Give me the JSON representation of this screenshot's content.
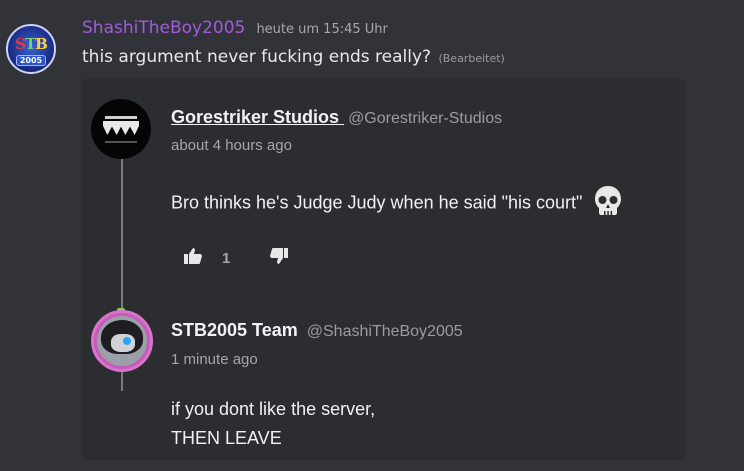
{
  "message": {
    "username": "ShashiTheBoy2005",
    "timestamp": "heute um 15:45 Uhr",
    "text": "this argument never fucking ends really?",
    "edited": "(Bearbeitet)",
    "avatar": {
      "line1": [
        "S",
        "T",
        "B"
      ],
      "line2": "2005"
    }
  },
  "embed": {
    "comment1": {
      "author": "Gorestriker Studios",
      "handle": "@Gorestriker-Studios",
      "time": "about 4 hours ago",
      "text": "Bro thinks he's Judge Judy when he said \"his court\"",
      "emoji_icon": "skull-icon",
      "like_count": "1"
    },
    "comment2": {
      "author": "STB2005 Team",
      "handle": "@ShashiTheBoy2005",
      "time": "1 minute ago",
      "lines": [
        "if you dont like the server,",
        "THEN LEAVE"
      ]
    }
  },
  "colors": {
    "background": "#313338",
    "embed_bg": "#2b2d31",
    "username": "#a25bdf"
  }
}
